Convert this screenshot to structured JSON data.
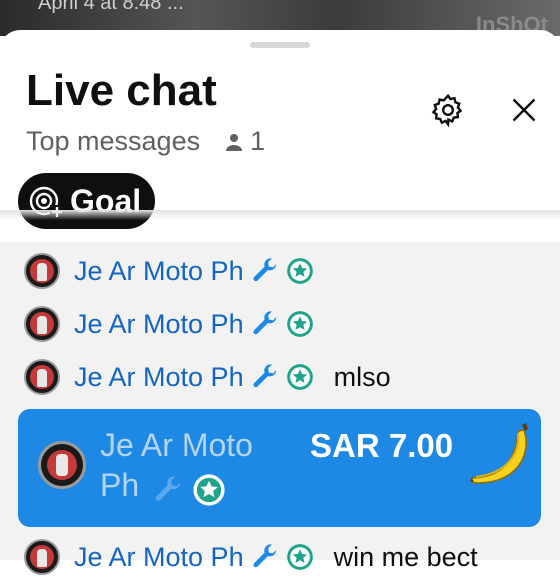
{
  "background_video": {
    "timestamp": "April 4 at 8:48 ...",
    "watermark": "InShOt"
  },
  "header": {
    "title": "Live chat",
    "mode": "Top messages",
    "viewer_count": "1",
    "goal_label": "Goal"
  },
  "messages": [
    {
      "author": "Je Ar Moto Ph",
      "text": ""
    },
    {
      "author": "Je Ar Moto Ph",
      "text": ""
    },
    {
      "author": "Je Ar Moto Ph",
      "text": "mlso"
    }
  ],
  "super_chat": {
    "author": "Je Ar Moto Ph",
    "amount": "SAR 7.00",
    "color": "#1e88e5",
    "sticker": "banana-sticker"
  },
  "partial_message": {
    "author": "Je Ar Moto Ph",
    "text": "win me bect"
  },
  "colors": {
    "author": "#1565c0",
    "moderator_badge": "#1e88e5",
    "member_badge": "#1fa38a"
  }
}
